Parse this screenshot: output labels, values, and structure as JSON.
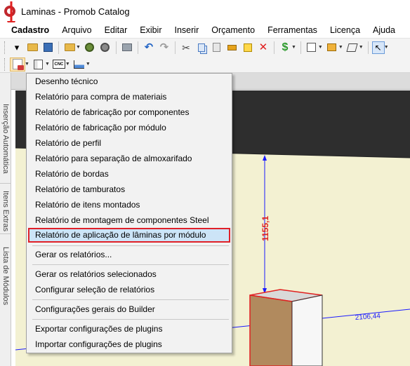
{
  "window": {
    "title": "Laminas - Promob Catalog"
  },
  "menubar": [
    "Cadastro",
    "Arquivo",
    "Editar",
    "Exibir",
    "Inserir",
    "Orçamento",
    "Ferramentas",
    "Licença",
    "Ajuda"
  ],
  "sidebar": {
    "tabs": [
      "Inserção Automática",
      "Itens Extras",
      "Lista de Módulos"
    ]
  },
  "context_menu": {
    "items": [
      "Desenho técnico",
      "Relatório para compra de materiais",
      "Relatório de fabricação por componentes",
      "Relatório de fabricação por módulo",
      "Relatório de perfil",
      "Relatório para separação de almoxarifado",
      "Relatório de bordas",
      "Relatório de tamburatos",
      "Relatório de itens montados",
      "Relatório de montagem de componentes Steel",
      "Relatório de aplicação de lâminas por módulo",
      "Gerar os relatórios...",
      "Gerar os relatórios selecionados",
      "Configurar seleção de relatórios",
      "Configurações gerais do Builder",
      "Exportar configurações de plugins",
      "Importar configurações de plugins"
    ],
    "highlighted_index": 10
  },
  "viewport": {
    "dimension_vertical": "1155,1",
    "dimension_horizontal": "2106,44"
  },
  "colors": {
    "highlight_fill": "#cce4f7",
    "highlight_border": "#e02028",
    "arrow": "#e02020",
    "dimension_line": "#1a1aff"
  }
}
